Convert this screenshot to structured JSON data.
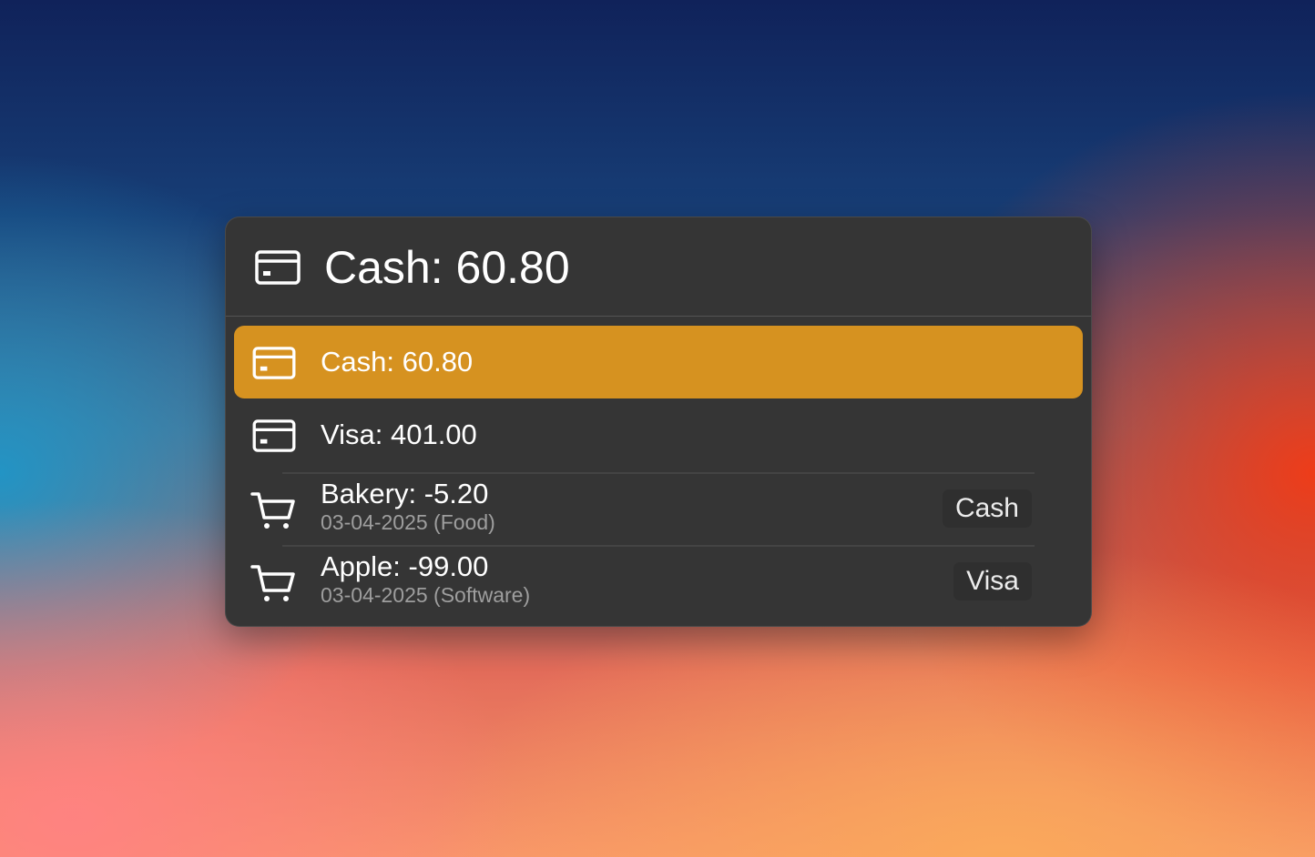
{
  "header": {
    "title": "Cash: 60.80",
    "icon": "credit-card-icon"
  },
  "results": [
    {
      "icon": "credit-card-icon",
      "label": "Cash: 60.80",
      "selected": true
    },
    {
      "icon": "credit-card-icon",
      "label": "Visa: 401.00",
      "selected": false
    },
    {
      "icon": "shopping-cart-icon",
      "label": "Bakery: -5.20",
      "subtitle": "03-04-2025 (Food)",
      "tag": "Cash"
    },
    {
      "icon": "shopping-cart-icon",
      "label": "Apple: -99.00",
      "subtitle": "03-04-2025 (Software)",
      "tag": "Visa"
    }
  ],
  "colors": {
    "accent": "#d69220",
    "panel_bg": "#353535",
    "text_primary": "#ffffff",
    "text_secondary": "#9e9e9e"
  }
}
